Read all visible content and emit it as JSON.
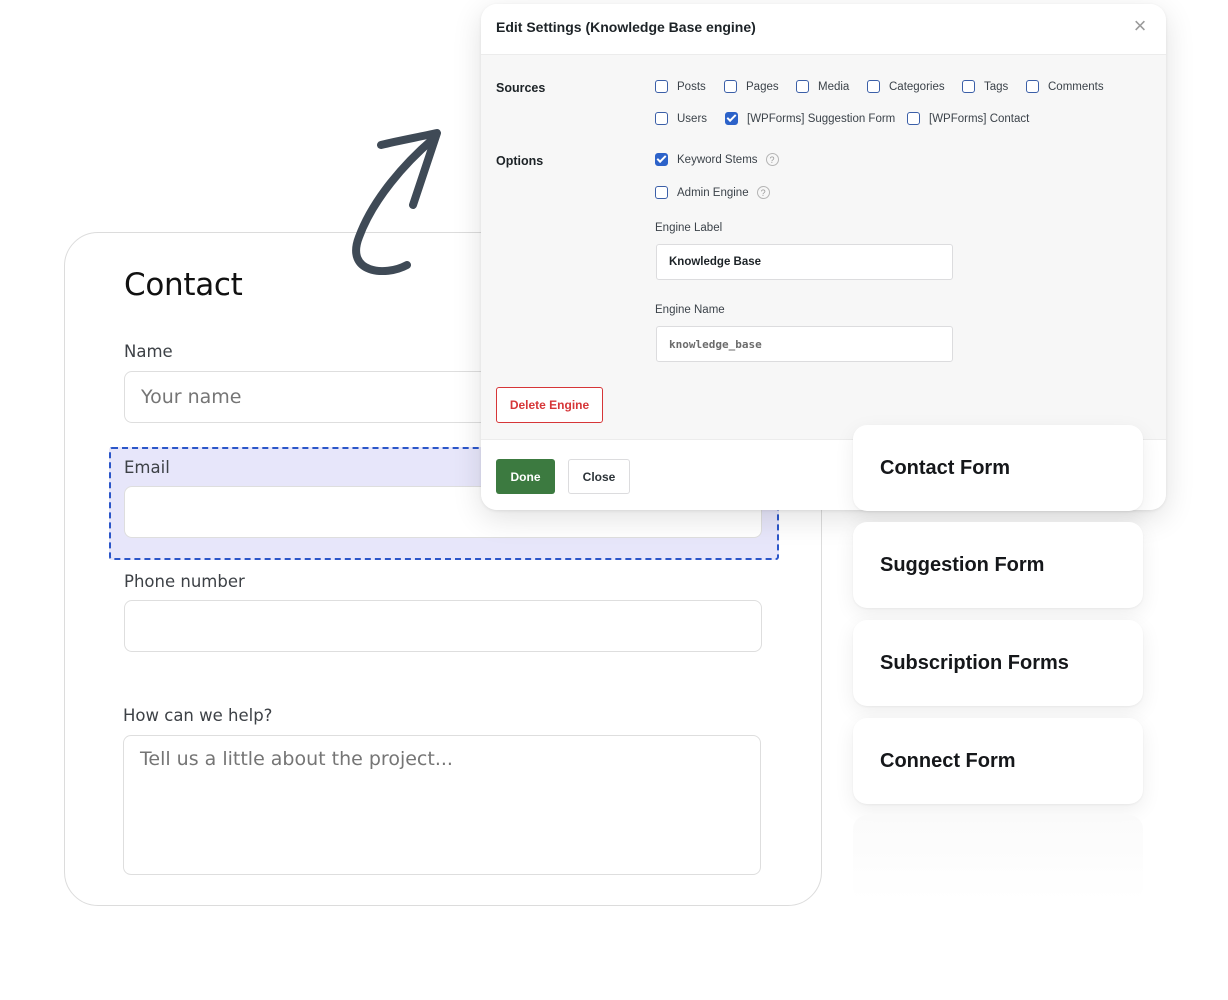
{
  "contact_form": {
    "title": "Contact",
    "fields": {
      "name": {
        "label": "Name",
        "placeholder": "Your name",
        "value": ""
      },
      "email": {
        "label": "Email",
        "placeholder": "",
        "value": ""
      },
      "phone": {
        "label": "Phone number",
        "placeholder": "",
        "value": ""
      },
      "help": {
        "label": "How can we help?",
        "placeholder": "Tell us a little about the project...",
        "value": ""
      }
    }
  },
  "modal": {
    "title": "Edit Settings (Knowledge Base engine)",
    "close_icon": "close-icon",
    "sources": {
      "label": "Sources",
      "items": [
        {
          "label": "Posts",
          "checked": false
        },
        {
          "label": "Pages",
          "checked": false
        },
        {
          "label": "Media",
          "checked": false
        },
        {
          "label": "Categories",
          "checked": false
        },
        {
          "label": "Tags",
          "checked": false
        },
        {
          "label": "Comments",
          "checked": false
        },
        {
          "label": "Users",
          "checked": false
        },
        {
          "label": "[WPForms] Suggestion Form",
          "checked": true
        },
        {
          "label": "[WPForms] Contact",
          "checked": false
        }
      ]
    },
    "options": {
      "label": "Options",
      "items": [
        {
          "label": "Keyword Stems",
          "checked": true,
          "help_icon": "question-circle-icon"
        },
        {
          "label": "Admin Engine",
          "checked": false,
          "help_icon": "question-circle-icon"
        }
      ]
    },
    "engine_label": {
      "label": "Engine Label",
      "value": "Knowledge Base"
    },
    "engine_name": {
      "label": "Engine Name",
      "value": "knowledge_base"
    },
    "delete_button": "Delete Engine",
    "done_button": "Done",
    "close_button": "Close",
    "colors": {
      "done": "#3c7a40",
      "delete": "#d63638",
      "checkbox": "#2c62c9"
    }
  },
  "form_list": [
    {
      "name": "Contact Form"
    },
    {
      "name": "Suggestion Form"
    },
    {
      "name": "Subscription Forms"
    },
    {
      "name": "Connect Form"
    }
  ],
  "decor": {
    "arrow_icon": "curved-arrow-icon",
    "highlight_color": "#e7e6fa",
    "highlight_border": "#2b56c9"
  }
}
